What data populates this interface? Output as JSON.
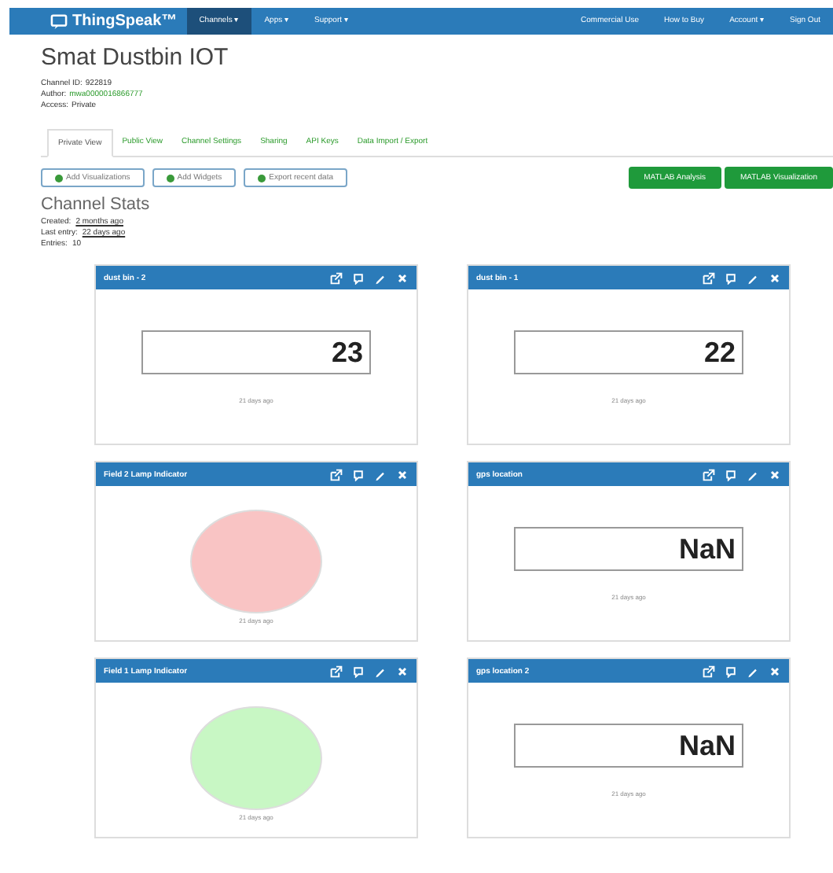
{
  "navbar": {
    "brand": "ThingSpeak™",
    "left_menu": [
      {
        "label": "Channels ▾",
        "selected": true
      },
      {
        "label": "Apps ▾",
        "selected": false
      },
      {
        "label": "Support ▾",
        "selected": false
      }
    ],
    "right_menu": [
      "Commercial Use",
      "How to Buy",
      "Account ▾",
      "Sign Out"
    ]
  },
  "channel": {
    "title": "Smat Dustbin IOT",
    "info": [
      {
        "label": "Channel ID:",
        "value": "922819",
        "kind": "plain"
      },
      {
        "label": "Author:",
        "value": "mwa0000016866777",
        "kind": "link"
      },
      {
        "label": "Access:",
        "value": "Private",
        "kind": "plain"
      }
    ]
  },
  "tabs": [
    {
      "label": "Private View",
      "selected": true
    },
    {
      "label": "Public View",
      "selected": false
    },
    {
      "label": "Channel Settings",
      "selected": false
    },
    {
      "label": "Sharing",
      "selected": false
    },
    {
      "label": "API Keys",
      "selected": false
    },
    {
      "label": "Data Import / Export",
      "selected": false
    }
  ],
  "actions": [
    "Add Visualizations",
    "Add Widgets",
    "Export recent data"
  ],
  "matlab_buttons": [
    "MATLAB Analysis",
    "MATLAB Visualization"
  ],
  "stats": {
    "title": "Channel Stats",
    "rows": [
      {
        "label": "Created:",
        "value": "2 months ago",
        "kind": "link"
      },
      {
        "label": "Last entry:",
        "value": "22 days ago",
        "kind": "link"
      },
      {
        "label": "Entries:",
        "value": "10",
        "kind": "plain"
      }
    ]
  },
  "widgets": [
    {
      "title": "dust bin - 2",
      "kind": "numeric",
      "value": "23",
      "updated": "21 days ago"
    },
    {
      "title": "dust bin - 1",
      "kind": "numeric",
      "value": "22",
      "updated": "21 days ago"
    },
    {
      "title": "Field 2 Lamp Indicator",
      "kind": "lamp",
      "color": "#f9c4c4",
      "updated": "21 days ago"
    },
    {
      "title": "gps location",
      "kind": "numeric",
      "value": "NaN",
      "updated": "21 days ago"
    },
    {
      "title": "Field 1 Lamp Indicator",
      "kind": "lamp",
      "color": "#c8f7c4",
      "updated": "21 days ago"
    },
    {
      "title": "gps location 2",
      "kind": "numeric",
      "value": "NaN",
      "updated": "21 days ago"
    }
  ]
}
